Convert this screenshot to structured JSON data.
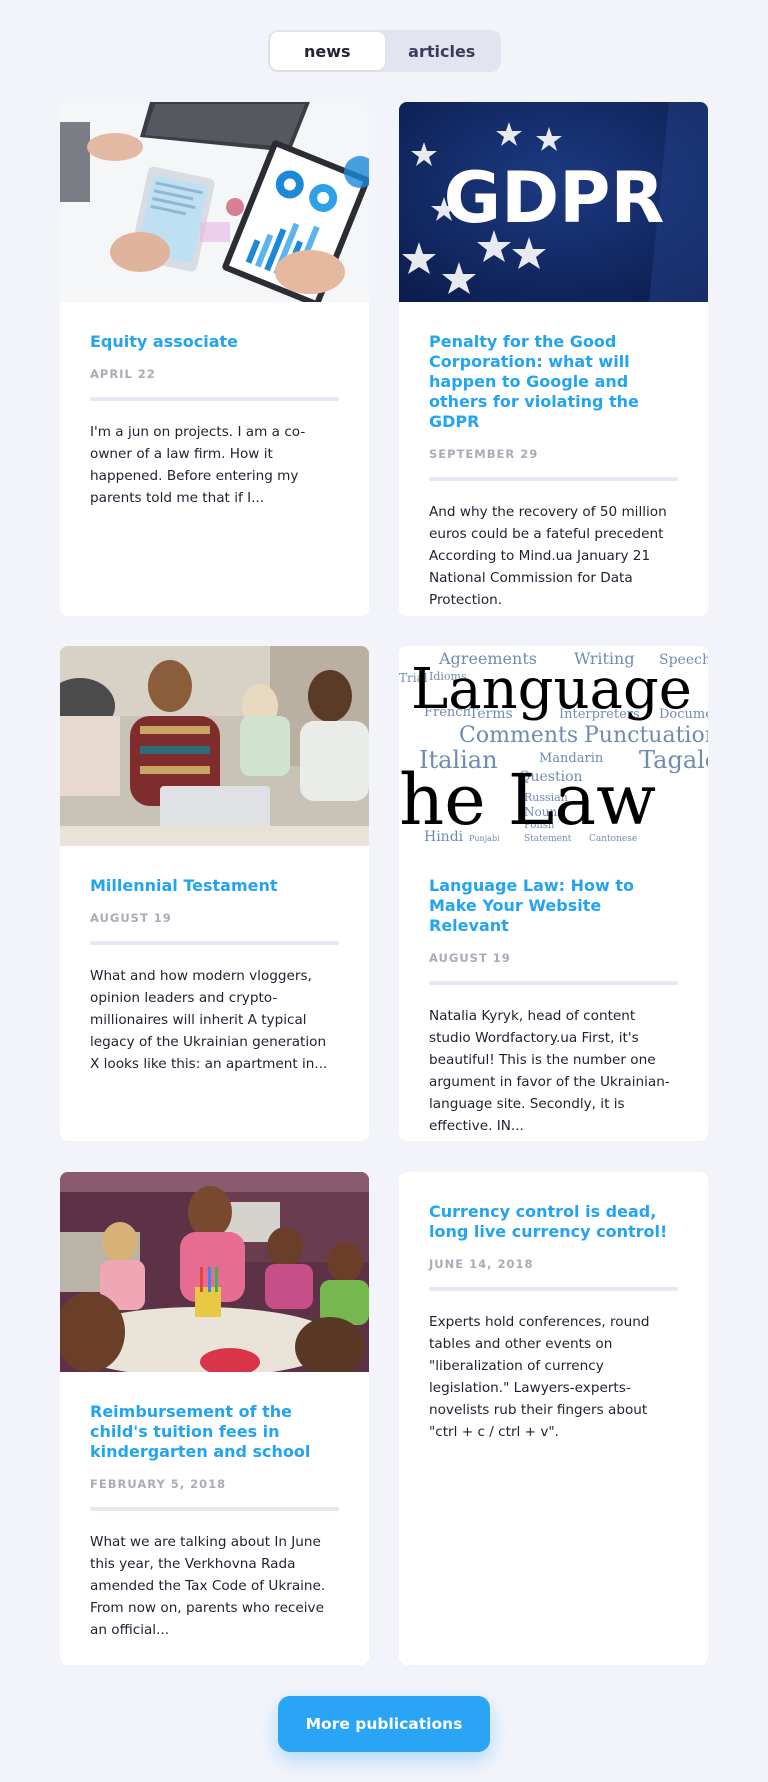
{
  "tabs": {
    "news": "news",
    "articles": "articles",
    "active": "news"
  },
  "cards": [
    {
      "title": "Equity associate",
      "date": "APRIL 22",
      "text": "I'm a jun on projects. I am a co-owner of a law firm. How it happened. Before entering my parents told me that if I...",
      "image": "business-charts-photo"
    },
    {
      "title": "Penalty for the Good Corporation: what will happen to Google and others for violating the GDPR",
      "date": "SEPTEMBER 29",
      "text": "And why the recovery of 50 million euros could be a fateful precedent According to Mind.ua January 21 National Commission for Data Protection.",
      "image": "gdpr-banner",
      "image_text": "GDPR"
    },
    {
      "title": "Millennial Testament",
      "date": "AUGUST 19",
      "text": "What and how modern vloggers, opinion leaders and crypto-millionaires will inherit A typical legacy of the Ukrainian generation X looks like this: an apartment in...",
      "image": "young-people-laptop-photo"
    },
    {
      "title": "Language Law: How to Make Your Website Relevant",
      "date": "AUGUST 19",
      "text": "Natalia Kyryk, head of content studio Wordfactory.ua First, it's beautiful! This is the number one argument in favor of the Ukrainian-language site. Secondly, it is effective. IN...",
      "image": "language-law-word-cloud",
      "image_text_1": "Language",
      "image_text_2": "the Law",
      "cloud_words": [
        "Agreements",
        "Idioms",
        "Writing",
        "Speech",
        "Trial",
        "French",
        "Terms",
        "Interpreters",
        "Document",
        "Comments",
        "Punctuation",
        "Italian",
        "Tagalog",
        "Mandarin",
        "Question",
        "Russian",
        "Nouns",
        "Polish",
        "Hindi",
        "Statement",
        "Cantonese",
        "Punjabi"
      ]
    },
    {
      "title": "Reimbursement of the child's tuition fees in kindergarten and school",
      "date": "FEBRUARY 5, 2018",
      "text": "What we are talking about In June this year, the Verkhovna Rada amended the Tax Code of Ukraine. From now on, parents who receive an official...",
      "image": "children-drawing-photo"
    },
    {
      "title": "Currency control is dead, long live currency control!",
      "date": "JUNE 14, 2018",
      "text": "Experts hold conferences, round tables and other events on \"liberalization of currency legislation.\" Lawyers-experts-novelists rub their fingers about \"ctrl + c / ctrl + v\"."
    }
  ],
  "more_button": "More publications",
  "colors": {
    "accent": "#23a4f2",
    "button": "#2aa5f5",
    "background": "#f3f4fa"
  }
}
